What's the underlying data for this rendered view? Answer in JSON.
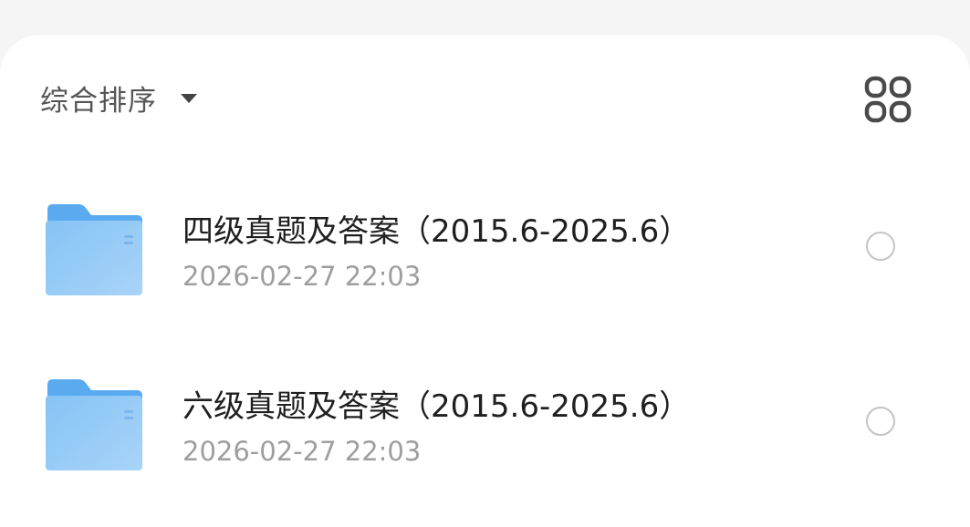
{
  "toolbar": {
    "sort_label": "综合排序",
    "sort_icon": "caret-down-icon",
    "view_toggle_icon": "grid-view-icon"
  },
  "files": [
    {
      "name": "四级真题及答案（2015.6-2025.6）",
      "modified": "2026-02-27 22:03",
      "icon": "folder-icon",
      "selected": false
    },
    {
      "name": "六级真题及答案（2015.6-2025.6）",
      "modified": "2026-02-27 22:03",
      "icon": "folder-icon",
      "selected": false
    }
  ],
  "colors": {
    "background": "#f5f5f5",
    "sheet": "#ffffff",
    "folder": "#64b5f6",
    "primary_text": "#1f1f1f",
    "secondary_text": "#9e9e9e"
  }
}
